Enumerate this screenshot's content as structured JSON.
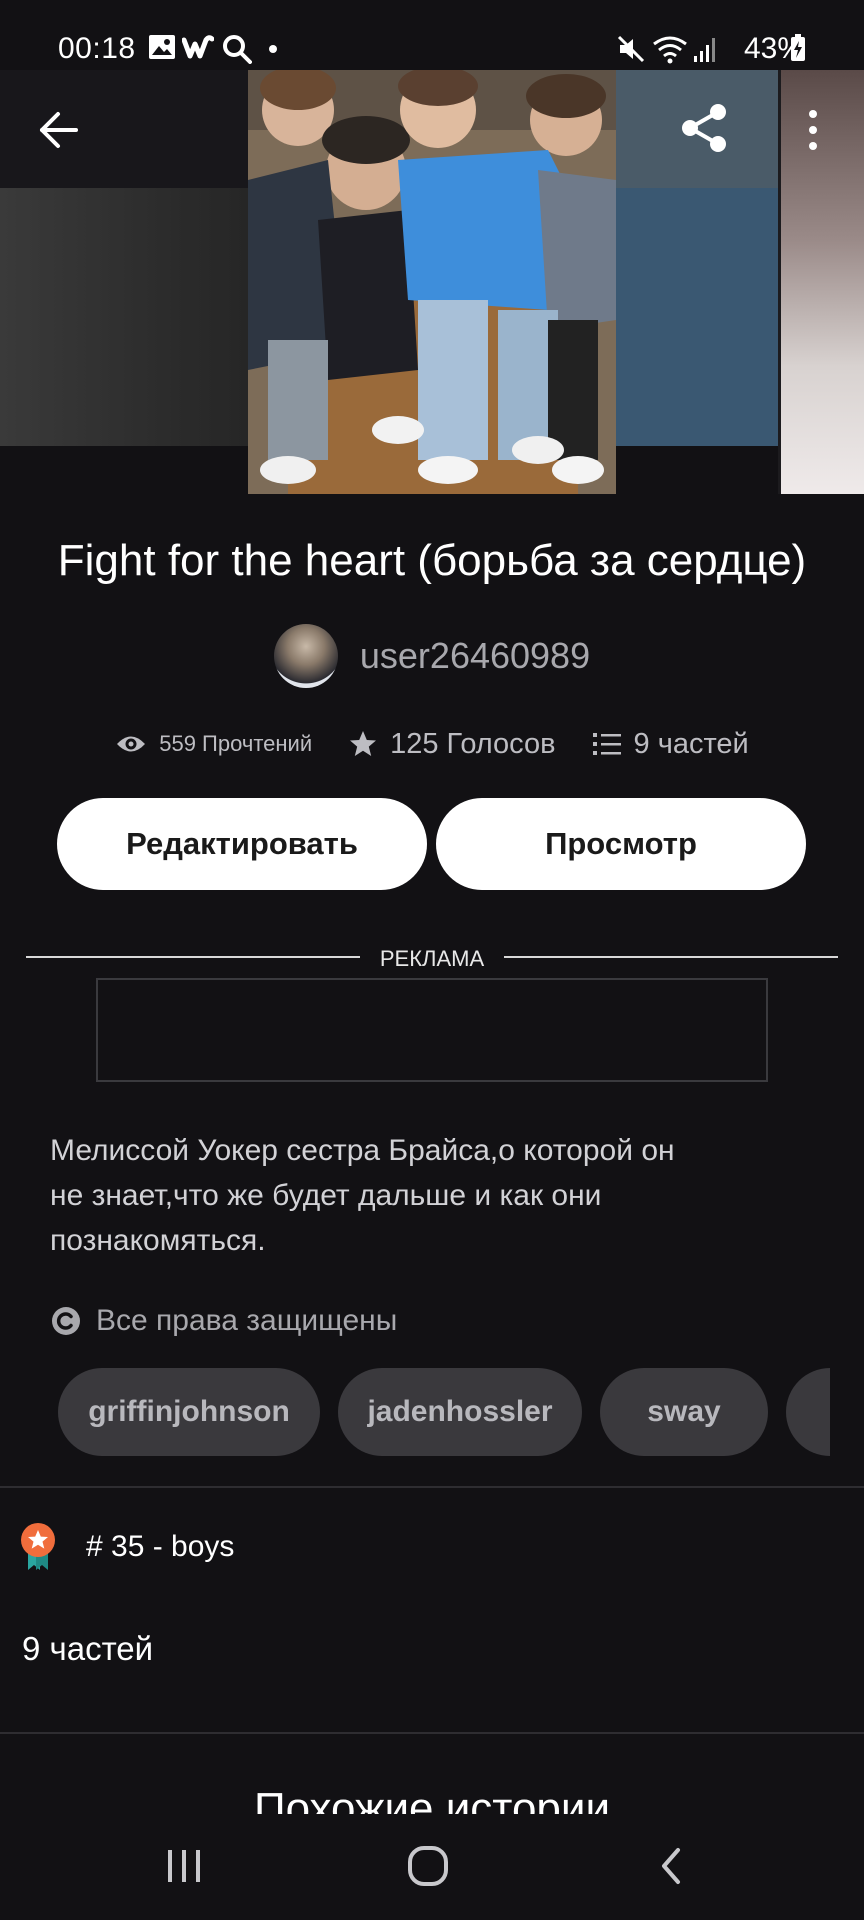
{
  "status_bar": {
    "time": "00:18",
    "battery": "43%",
    "icons": [
      "gallery-icon",
      "wattpad-icon",
      "search-icon",
      "dot-icon",
      "mute-icon",
      "wifi-icon",
      "signal-icon",
      "battery-charging-icon"
    ]
  },
  "header": {
    "back_icon": "arrow-left-icon",
    "share_icon": "share-icon",
    "more_icon": "more-vertical-icon"
  },
  "story": {
    "title": "Fight for the heart (борьба за сердце)",
    "author": "user26460989",
    "stats": {
      "reads": "559 Прочтений",
      "votes": "125 Голосов",
      "parts": "9 частей"
    },
    "description": "Мелиссой Уокер сестра Брайса,о которой он не знает,что же будет дальше и как они познакомяться.",
    "copyright": "Все права защищены",
    "tags": [
      "griffinjohnson",
      "jadenhossler",
      "sway",
      ""
    ],
    "ranking": "# 35 - boys",
    "parts_heading": "9 частей"
  },
  "buttons": {
    "edit": "Редактировать",
    "preview": "Просмотр"
  },
  "ad": {
    "label": "РЕКЛАМА"
  },
  "similar": {
    "title": "Похожие истории"
  },
  "colors": {
    "background": "#121114",
    "button_bg": "#ffffff",
    "tag_bg": "#3a393d",
    "rank_badge": "#f06d3c",
    "rank_ribbon": "#2aa6a0"
  }
}
